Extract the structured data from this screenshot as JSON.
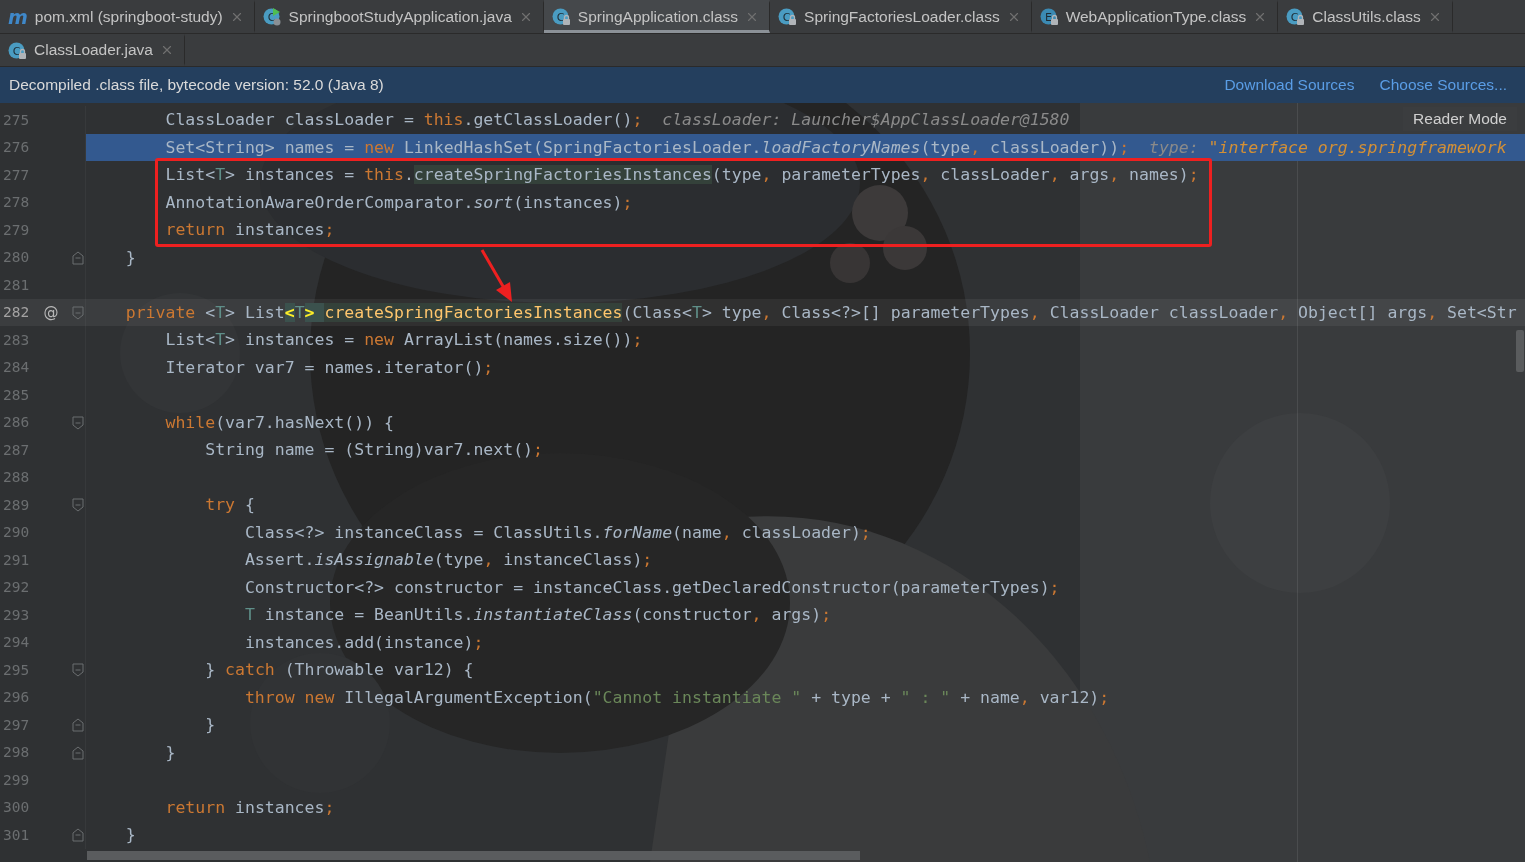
{
  "tabs": [
    [
      {
        "label": "pom.xml (springboot-study)",
        "icon": {
          "kind": "maven",
          "letter": "m"
        },
        "selected": false
      },
      {
        "label": "SpringbootStudyApplication.java",
        "icon": {
          "kind": "class_runnable",
          "letter": "C"
        },
        "selected": false
      },
      {
        "label": "SpringApplication.class",
        "icon": {
          "kind": "class",
          "letter": "C"
        },
        "selected": true
      },
      {
        "label": "SpringFactoriesLoader.class",
        "icon": {
          "kind": "class",
          "letter": "C"
        },
        "selected": false
      },
      {
        "label": "WebApplicationType.class",
        "icon": {
          "kind": "enum",
          "letter": "E"
        },
        "selected": false
      },
      {
        "label": "ClassUtils.class",
        "icon": {
          "kind": "class",
          "letter": "C"
        },
        "selected": false
      }
    ],
    [
      {
        "label": "ClassLoader.java",
        "icon": {
          "kind": "class",
          "letter": "C"
        },
        "selected": false
      }
    ]
  ],
  "banner": {
    "text": "Decompiled .class file, bytecode version: 52.0 (Java 8)",
    "links": [
      "Download Sources",
      "Choose Sources..."
    ]
  },
  "editor": {
    "reader_mode": "Reader Mode",
    "lines": [
      {
        "number": "275",
        "highlighted": false,
        "caret": false,
        "boxed": false,
        "tokens": [
          {
            "kind": "plain",
            "text": "        ClassLoader classLoader = "
          },
          {
            "kind": "keyword",
            "text": "this"
          },
          {
            "kind": "plain",
            "text": ".getClassLoader()"
          },
          {
            "kind": "punct",
            "text": ";  "
          },
          {
            "kind": "hint",
            "text": "classLoader: Launcher$AppClassLoader@1580"
          }
        ]
      },
      {
        "number": "276",
        "highlighted": true,
        "caret": false,
        "boxed": false,
        "tokens": [
          {
            "kind": "plain",
            "text": "        Set<String> names = "
          },
          {
            "kind": "keyword",
            "text": "new"
          },
          {
            "kind": "plain",
            "text": " LinkedHashSet(SpringFactoriesLoader."
          },
          {
            "kind": "static",
            "text": "loadFactoryNames"
          },
          {
            "kind": "plain",
            "text": "(type"
          },
          {
            "kind": "punct",
            "text": ","
          },
          {
            "kind": "plain",
            "text": " classLoader))"
          },
          {
            "kind": "punct",
            "text": ";  "
          },
          {
            "kind": "hint",
            "text": "type: "
          },
          {
            "kind": "hint_value",
            "text": "\"interface org.springframework"
          }
        ]
      },
      {
        "number": "277",
        "highlighted": false,
        "caret": false,
        "boxed": true,
        "tokens": [
          {
            "kind": "plain",
            "text": "        List<"
          },
          {
            "kind": "typeparam",
            "text": "T"
          },
          {
            "kind": "plain",
            "text": "> instances = "
          },
          {
            "kind": "keyword",
            "text": "this"
          },
          {
            "kind": "plain",
            "text": "."
          },
          {
            "kind": "usage",
            "text": "createSpringFactoriesInstances"
          },
          {
            "kind": "plain",
            "text": "(type"
          },
          {
            "kind": "punct",
            "text": ","
          },
          {
            "kind": "plain",
            "text": " parameterTypes"
          },
          {
            "kind": "punct",
            "text": ","
          },
          {
            "kind": "plain",
            "text": " classLoader"
          },
          {
            "kind": "punct",
            "text": ","
          },
          {
            "kind": "plain",
            "text": " args"
          },
          {
            "kind": "punct",
            "text": ","
          },
          {
            "kind": "plain",
            "text": " names)"
          },
          {
            "kind": "punct",
            "text": ";"
          }
        ]
      },
      {
        "number": "278",
        "highlighted": false,
        "caret": false,
        "boxed": true,
        "tokens": [
          {
            "kind": "plain",
            "text": "        AnnotationAwareOrderComparator."
          },
          {
            "kind": "static",
            "text": "sort"
          },
          {
            "kind": "plain",
            "text": "(instances)"
          },
          {
            "kind": "punct",
            "text": ";"
          }
        ]
      },
      {
        "number": "279",
        "highlighted": false,
        "caret": false,
        "boxed": true,
        "tokens": [
          {
            "kind": "keyword",
            "text": "        return"
          },
          {
            "kind": "plain",
            "text": " instances"
          },
          {
            "kind": "punct",
            "text": ";"
          }
        ]
      },
      {
        "number": "280",
        "fold": {
          "kind": "end"
        },
        "highlighted": false,
        "caret": false,
        "boxed": false,
        "tokens": [
          {
            "kind": "plain",
            "text": "    }"
          }
        ]
      },
      {
        "number": "281",
        "highlighted": false,
        "caret": false,
        "boxed": false
      },
      {
        "number": "282",
        "marker": "@",
        "fold": {
          "kind": "start"
        },
        "highlighted": false,
        "caret": true,
        "boxed": false,
        "tokens": [
          {
            "kind": "keyword",
            "text": "    private"
          },
          {
            "kind": "plain",
            "text": " <"
          },
          {
            "kind": "typeparam",
            "text": "T"
          },
          {
            "kind": "plain",
            "text": "> List"
          },
          {
            "kind": "match",
            "text": "<"
          },
          {
            "kind": "typeparam",
            "text": "T"
          },
          {
            "kind": "match",
            "text": "> "
          },
          {
            "kind": "declaration",
            "text": "createSpringFactoriesInstances"
          },
          {
            "kind": "plain",
            "text": "(Class<"
          },
          {
            "kind": "typeparam",
            "text": "T"
          },
          {
            "kind": "plain",
            "text": "> type"
          },
          {
            "kind": "punct",
            "text": ","
          },
          {
            "kind": "plain",
            "text": " Class<?>[] parameterTypes"
          },
          {
            "kind": "punct",
            "text": ","
          },
          {
            "kind": "plain",
            "text": " ClassLoader classLoader"
          },
          {
            "kind": "punct",
            "text": ","
          },
          {
            "kind": "plain",
            "text": " Object[] args"
          },
          {
            "kind": "punct",
            "text": ","
          },
          {
            "kind": "plain",
            "text": " Set<Str"
          }
        ]
      },
      {
        "number": "283",
        "highlighted": false,
        "caret": false,
        "boxed": false,
        "tokens": [
          {
            "kind": "plain",
            "text": "        List<"
          },
          {
            "kind": "typeparam",
            "text": "T"
          },
          {
            "kind": "plain",
            "text": "> instances = "
          },
          {
            "kind": "keyword",
            "text": "new"
          },
          {
            "kind": "plain",
            "text": " ArrayList(names.size())"
          },
          {
            "kind": "punct",
            "text": ";"
          }
        ]
      },
      {
        "number": "284",
        "highlighted": false,
        "caret": false,
        "boxed": false,
        "tokens": [
          {
            "kind": "plain",
            "text": "        Iterator var7 = names.iterator()"
          },
          {
            "kind": "punct",
            "text": ";"
          }
        ]
      },
      {
        "number": "285",
        "highlighted": false,
        "caret": false,
        "boxed": false
      },
      {
        "number": "286",
        "fold": {
          "kind": "start"
        },
        "highlighted": false,
        "caret": false,
        "boxed": false,
        "tokens": [
          {
            "kind": "keyword",
            "text": "        while"
          },
          {
            "kind": "plain",
            "text": "(var7.hasNext()) {"
          }
        ]
      },
      {
        "number": "287",
        "highlighted": false,
        "caret": false,
        "boxed": false,
        "tokens": [
          {
            "kind": "plain",
            "text": "            String name = (String)var7.next()"
          },
          {
            "kind": "punct",
            "text": ";"
          }
        ]
      },
      {
        "number": "288",
        "highlighted": false,
        "caret": false,
        "boxed": false
      },
      {
        "number": "289",
        "fold": {
          "kind": "start"
        },
        "highlighted": false,
        "caret": false,
        "boxed": false,
        "tokens": [
          {
            "kind": "keyword",
            "text": "            try"
          },
          {
            "kind": "plain",
            "text": " {"
          }
        ]
      },
      {
        "number": "290",
        "highlighted": false,
        "caret": false,
        "boxed": false,
        "tokens": [
          {
            "kind": "plain",
            "text": "                Class<?> instanceClass = ClassUtils."
          },
          {
            "kind": "static",
            "text": "forName"
          },
          {
            "kind": "plain",
            "text": "(name"
          },
          {
            "kind": "punct",
            "text": ","
          },
          {
            "kind": "plain",
            "text": " classLoader)"
          },
          {
            "kind": "punct",
            "text": ";"
          }
        ]
      },
      {
        "number": "291",
        "highlighted": false,
        "caret": false,
        "boxed": false,
        "tokens": [
          {
            "kind": "plain",
            "text": "                Assert."
          },
          {
            "kind": "static",
            "text": "isAssignable"
          },
          {
            "kind": "plain",
            "text": "(type"
          },
          {
            "kind": "punct",
            "text": ","
          },
          {
            "kind": "plain",
            "text": " instanceClass)"
          },
          {
            "kind": "punct",
            "text": ";"
          }
        ]
      },
      {
        "number": "292",
        "highlighted": false,
        "caret": false,
        "boxed": false,
        "tokens": [
          {
            "kind": "plain",
            "text": "                Constructor<?> constructor = instanceClass.getDeclaredConstructor(parameterTypes)"
          },
          {
            "kind": "punct",
            "text": ";"
          }
        ]
      },
      {
        "number": "293",
        "highlighted": false,
        "caret": false,
        "boxed": false,
        "tokens": [
          {
            "kind": "typeparam",
            "text": "                T"
          },
          {
            "kind": "plain",
            "text": " instance = BeanUtils."
          },
          {
            "kind": "static",
            "text": "instantiateClass"
          },
          {
            "kind": "plain",
            "text": "(constructor"
          },
          {
            "kind": "punct",
            "text": ","
          },
          {
            "kind": "plain",
            "text": " args)"
          },
          {
            "kind": "punct",
            "text": ";"
          }
        ]
      },
      {
        "number": "294",
        "highlighted": false,
        "caret": false,
        "boxed": false,
        "tokens": [
          {
            "kind": "plain",
            "text": "                instances.add(instance)"
          },
          {
            "kind": "punct",
            "text": ";"
          }
        ]
      },
      {
        "number": "295",
        "fold": {
          "kind": "start"
        },
        "highlighted": false,
        "caret": false,
        "boxed": false,
        "tokens": [
          {
            "kind": "plain",
            "text": "            } "
          },
          {
            "kind": "keyword",
            "text": "catch"
          },
          {
            "kind": "plain",
            "text": " (Throwable var12) {"
          }
        ]
      },
      {
        "number": "296",
        "highlighted": false,
        "caret": false,
        "boxed": false,
        "tokens": [
          {
            "kind": "keyword",
            "text": "                throw new"
          },
          {
            "kind": "plain",
            "text": " IllegalArgumentException("
          },
          {
            "kind": "string",
            "text": "\"Cannot instantiate \""
          },
          {
            "kind": "plain",
            "text": " + type + "
          },
          {
            "kind": "string",
            "text": "\" : \""
          },
          {
            "kind": "plain",
            "text": " + name"
          },
          {
            "kind": "punct",
            "text": ","
          },
          {
            "kind": "plain",
            "text": " var12)"
          },
          {
            "kind": "punct",
            "text": ";"
          }
        ]
      },
      {
        "number": "297",
        "fold": {
          "kind": "end"
        },
        "highlighted": false,
        "caret": false,
        "boxed": false,
        "tokens": [
          {
            "kind": "plain",
            "text": "            }"
          }
        ]
      },
      {
        "number": "298",
        "fold": {
          "kind": "end"
        },
        "highlighted": false,
        "caret": false,
        "boxed": false,
        "tokens": [
          {
            "kind": "plain",
            "text": "        }"
          }
        ]
      },
      {
        "number": "299",
        "highlighted": false,
        "caret": false,
        "boxed": false
      },
      {
        "number": "300",
        "highlighted": false,
        "caret": false,
        "boxed": false,
        "tokens": [
          {
            "kind": "keyword",
            "text": "        return"
          },
          {
            "kind": "plain",
            "text": " instances"
          },
          {
            "kind": "punct",
            "text": ";"
          }
        ]
      },
      {
        "number": "301",
        "fold": {
          "kind": "end"
        },
        "highlighted": false,
        "caret": false,
        "boxed": false,
        "tokens": [
          {
            "kind": "plain",
            "text": "    }"
          }
        ]
      }
    ]
  }
}
